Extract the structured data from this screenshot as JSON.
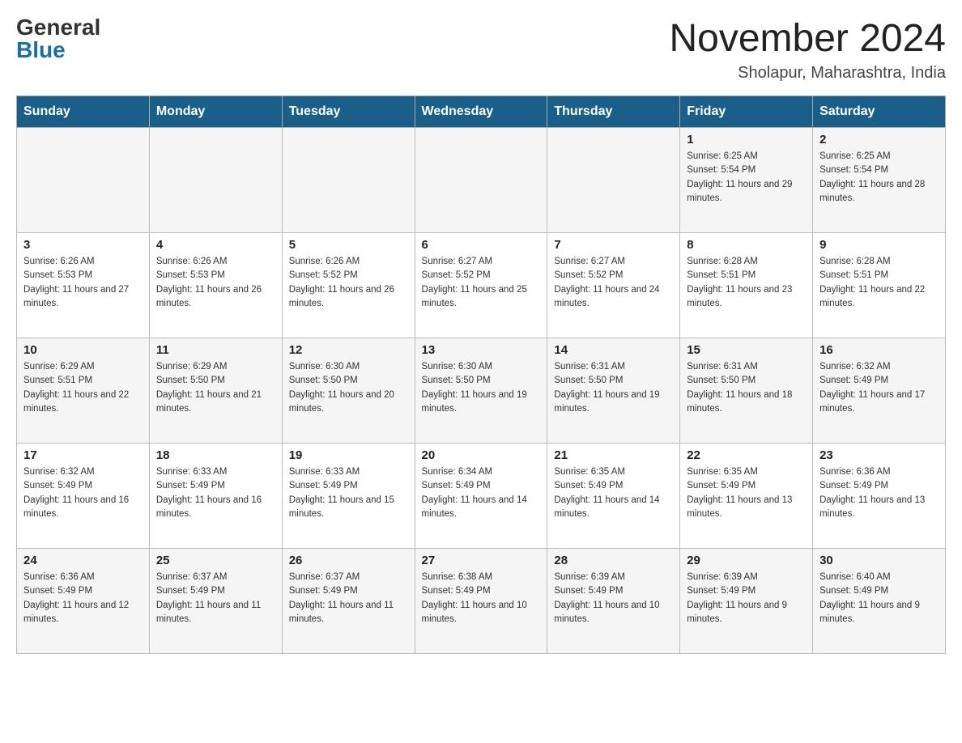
{
  "header": {
    "logo_general": "General",
    "logo_blue": "Blue",
    "month_title": "November 2024",
    "location": "Sholapur, Maharashtra, India"
  },
  "days_of_week": [
    "Sunday",
    "Monday",
    "Tuesday",
    "Wednesday",
    "Thursday",
    "Friday",
    "Saturday"
  ],
  "weeks": [
    [
      {
        "day": "",
        "info": ""
      },
      {
        "day": "",
        "info": ""
      },
      {
        "day": "",
        "info": ""
      },
      {
        "day": "",
        "info": ""
      },
      {
        "day": "",
        "info": ""
      },
      {
        "day": "1",
        "info": "Sunrise: 6:25 AM\nSunset: 5:54 PM\nDaylight: 11 hours and 29 minutes."
      },
      {
        "day": "2",
        "info": "Sunrise: 6:25 AM\nSunset: 5:54 PM\nDaylight: 11 hours and 28 minutes."
      }
    ],
    [
      {
        "day": "3",
        "info": "Sunrise: 6:26 AM\nSunset: 5:53 PM\nDaylight: 11 hours and 27 minutes."
      },
      {
        "day": "4",
        "info": "Sunrise: 6:26 AM\nSunset: 5:53 PM\nDaylight: 11 hours and 26 minutes."
      },
      {
        "day": "5",
        "info": "Sunrise: 6:26 AM\nSunset: 5:52 PM\nDaylight: 11 hours and 26 minutes."
      },
      {
        "day": "6",
        "info": "Sunrise: 6:27 AM\nSunset: 5:52 PM\nDaylight: 11 hours and 25 minutes."
      },
      {
        "day": "7",
        "info": "Sunrise: 6:27 AM\nSunset: 5:52 PM\nDaylight: 11 hours and 24 minutes."
      },
      {
        "day": "8",
        "info": "Sunrise: 6:28 AM\nSunset: 5:51 PM\nDaylight: 11 hours and 23 minutes."
      },
      {
        "day": "9",
        "info": "Sunrise: 6:28 AM\nSunset: 5:51 PM\nDaylight: 11 hours and 22 minutes."
      }
    ],
    [
      {
        "day": "10",
        "info": "Sunrise: 6:29 AM\nSunset: 5:51 PM\nDaylight: 11 hours and 22 minutes."
      },
      {
        "day": "11",
        "info": "Sunrise: 6:29 AM\nSunset: 5:50 PM\nDaylight: 11 hours and 21 minutes."
      },
      {
        "day": "12",
        "info": "Sunrise: 6:30 AM\nSunset: 5:50 PM\nDaylight: 11 hours and 20 minutes."
      },
      {
        "day": "13",
        "info": "Sunrise: 6:30 AM\nSunset: 5:50 PM\nDaylight: 11 hours and 19 minutes."
      },
      {
        "day": "14",
        "info": "Sunrise: 6:31 AM\nSunset: 5:50 PM\nDaylight: 11 hours and 19 minutes."
      },
      {
        "day": "15",
        "info": "Sunrise: 6:31 AM\nSunset: 5:50 PM\nDaylight: 11 hours and 18 minutes."
      },
      {
        "day": "16",
        "info": "Sunrise: 6:32 AM\nSunset: 5:49 PM\nDaylight: 11 hours and 17 minutes."
      }
    ],
    [
      {
        "day": "17",
        "info": "Sunrise: 6:32 AM\nSunset: 5:49 PM\nDaylight: 11 hours and 16 minutes."
      },
      {
        "day": "18",
        "info": "Sunrise: 6:33 AM\nSunset: 5:49 PM\nDaylight: 11 hours and 16 minutes."
      },
      {
        "day": "19",
        "info": "Sunrise: 6:33 AM\nSunset: 5:49 PM\nDaylight: 11 hours and 15 minutes."
      },
      {
        "day": "20",
        "info": "Sunrise: 6:34 AM\nSunset: 5:49 PM\nDaylight: 11 hours and 14 minutes."
      },
      {
        "day": "21",
        "info": "Sunrise: 6:35 AM\nSunset: 5:49 PM\nDaylight: 11 hours and 14 minutes."
      },
      {
        "day": "22",
        "info": "Sunrise: 6:35 AM\nSunset: 5:49 PM\nDaylight: 11 hours and 13 minutes."
      },
      {
        "day": "23",
        "info": "Sunrise: 6:36 AM\nSunset: 5:49 PM\nDaylight: 11 hours and 13 minutes."
      }
    ],
    [
      {
        "day": "24",
        "info": "Sunrise: 6:36 AM\nSunset: 5:49 PM\nDaylight: 11 hours and 12 minutes."
      },
      {
        "day": "25",
        "info": "Sunrise: 6:37 AM\nSunset: 5:49 PM\nDaylight: 11 hours and 11 minutes."
      },
      {
        "day": "26",
        "info": "Sunrise: 6:37 AM\nSunset: 5:49 PM\nDaylight: 11 hours and 11 minutes."
      },
      {
        "day": "27",
        "info": "Sunrise: 6:38 AM\nSunset: 5:49 PM\nDaylight: 11 hours and 10 minutes."
      },
      {
        "day": "28",
        "info": "Sunrise: 6:39 AM\nSunset: 5:49 PM\nDaylight: 11 hours and 10 minutes."
      },
      {
        "day": "29",
        "info": "Sunrise: 6:39 AM\nSunset: 5:49 PM\nDaylight: 11 hours and 9 minutes."
      },
      {
        "day": "30",
        "info": "Sunrise: 6:40 AM\nSunset: 5:49 PM\nDaylight: 11 hours and 9 minutes."
      }
    ]
  ]
}
